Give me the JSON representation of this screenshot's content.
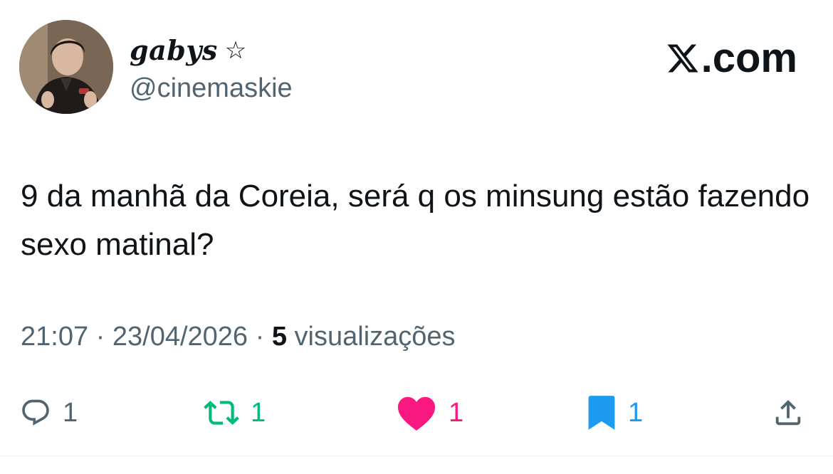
{
  "author": {
    "display_name": "gabys",
    "badge": "☆",
    "handle": "@cinemaskie"
  },
  "brand": {
    "logo_icon": "x-logo-icon",
    "domain": ".com"
  },
  "tweet": {
    "text": "9 da manhã da Coreia, será q os minsung estão fazendo sexo matinal?",
    "time": "21:07",
    "separator": " · ",
    "date": "23/04/2026",
    "views_count": "5",
    "views_label": "visualizações"
  },
  "actions": {
    "reply_count": "1",
    "retweet_count": "1",
    "like_count": "1",
    "bookmark_count": "1"
  },
  "colors": {
    "retweet": "#00ba7c",
    "like": "#f91880",
    "bookmark": "#1d9bf0",
    "secondary_text": "#536471"
  }
}
